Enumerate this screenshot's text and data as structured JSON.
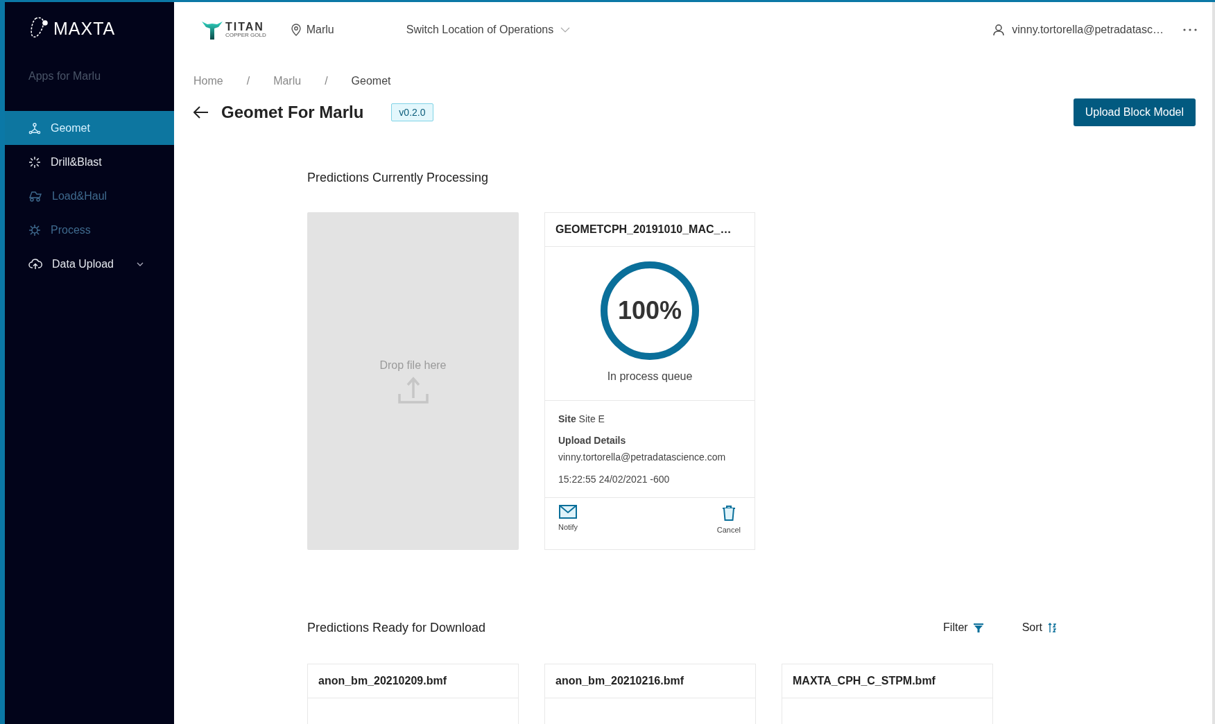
{
  "sidebar": {
    "brand": "MAXTA",
    "subtitle": "Apps for Marlu",
    "items": [
      {
        "label": "Geomet",
        "kind": "link",
        "selected": true,
        "disabled": false
      },
      {
        "label": "Drill&Blast",
        "kind": "link",
        "selected": false,
        "disabled": false
      },
      {
        "label": "Load&Haul",
        "kind": "link",
        "selected": false,
        "disabled": true
      },
      {
        "label": "Process",
        "kind": "link",
        "selected": false,
        "disabled": true
      },
      {
        "label": "Data Upload",
        "kind": "group",
        "selected": false,
        "disabled": false,
        "expanded": false
      }
    ]
  },
  "header": {
    "logo": {
      "name": "TITAN",
      "tagline": "COPPER GOLD"
    },
    "location": "Marlu",
    "switch_location": "Switch Location of Operations",
    "user": "vinny.tortorella@petradatasc…"
  },
  "breadcrumb": {
    "separator": "/",
    "items": [
      {
        "label": "Home",
        "current": false
      },
      {
        "label": "Marlu",
        "current": false
      },
      {
        "label": "Geomet",
        "current": true
      }
    ]
  },
  "page": {
    "title": "Geomet For Marlu",
    "version": "v0.2.0",
    "action": "Upload Block Model"
  },
  "processing": {
    "heading": "Predictions Currently Processing",
    "dropzone": {
      "prompt": "Drop file here"
    },
    "jobs": [
      {
        "name": "GEOMETCPH_20191010_MAC_…",
        "level": 1,
        "percent": "100%",
        "status": "In process queue",
        "site": "**Site** Site E",
        "details_label": "Upload Details",
        "uploader": "vinny.tortorella@petradatascience.com",
        "timestamp": "15:22:55 24/02/2021 -600",
        "actions": [
          {
            "label": "Notify",
            "kind": "notify"
          },
          {
            "label": "Cancel",
            "kind": "cancel"
          }
        ]
      }
    ]
  },
  "ready": {
    "heading": "Predictions Ready for Download",
    "filter": "Filter",
    "sort": "Sort",
    "files": [
      {
        "name": "anon_bm_20210209.bmf"
      },
      {
        "name": "anon_bm_20210216.bmf"
      },
      {
        "name": "MAXTA_CPH_C_STPM.bmf"
      }
    ]
  }
}
